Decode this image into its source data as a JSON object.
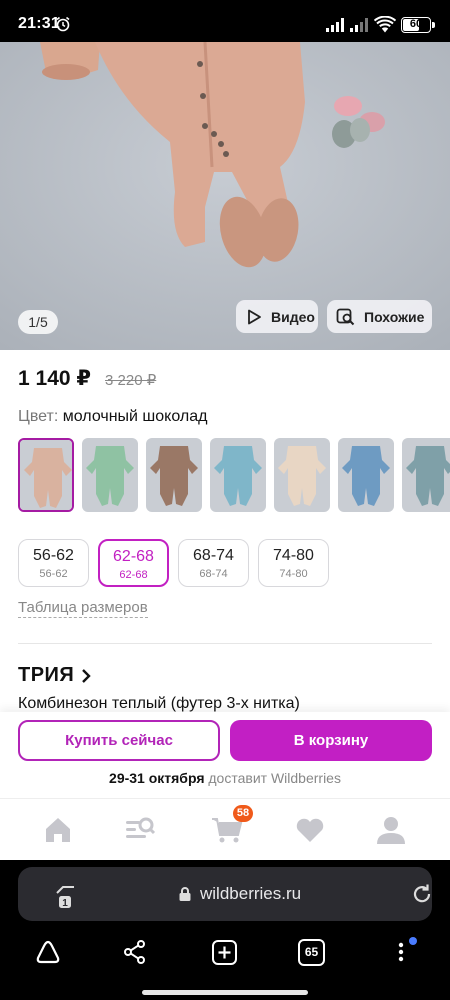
{
  "status_bar": {
    "time": "21:31",
    "battery": "60"
  },
  "photo": {
    "counter": "1/5",
    "video_label": "Видео",
    "similar_label": "Похожие"
  },
  "product": {
    "price": "1 140 ₽",
    "old_price": "3 220 ₽",
    "color_label": "Цвет:",
    "color_value": "молочный шоколад",
    "swatch_colors": [
      "#d9b29f",
      "#8fc2a3",
      "#9a7866",
      "#7fb6c9",
      "#e8d6c4",
      "#6e9bc2",
      "#7fa0a8"
    ],
    "sizes": [
      {
        "main": "56-62",
        "sub": "56-62",
        "selected": false
      },
      {
        "main": "62-68",
        "sub": "62-68",
        "selected": true
      },
      {
        "main": "68-74",
        "sub": "68-74",
        "selected": false
      },
      {
        "main": "74-80",
        "sub": "74-80",
        "selected": false
      }
    ],
    "size_table_link": "Таблица размеров",
    "brand": "ТРИЯ",
    "name": "Комбинезон теплый (футер 3-х нитка)"
  },
  "actions": {
    "buy_now": "Купить сейчас",
    "add_to_cart": "В корзину",
    "delivery_date": "29-31 октября",
    "delivery_text": " доставит Wildberries"
  },
  "tab_bar": {
    "cart_count": "58",
    "icons": [
      "home-icon",
      "catalog-search-icon",
      "cart-icon",
      "favorites-icon",
      "profile-icon"
    ]
  },
  "browser": {
    "url": "wildberries.ru",
    "tab_count": "65",
    "site_tabs": "1"
  },
  "colors": {
    "accent": "#c21fc4",
    "badge": "#f05a1a",
    "photo_bg": "#b8bec6"
  }
}
